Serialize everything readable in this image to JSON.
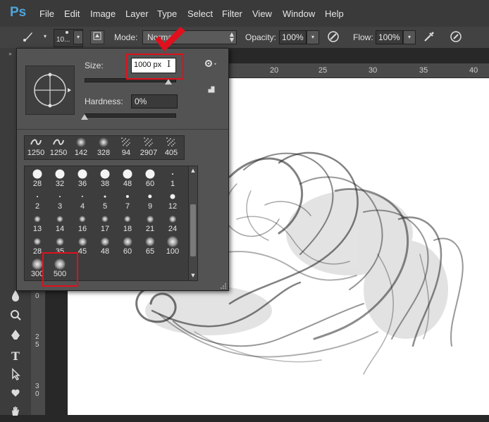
{
  "app": {
    "logo": "Ps"
  },
  "menu": [
    "File",
    "Edit",
    "Image",
    "Layer",
    "Type",
    "Select",
    "Filter",
    "View",
    "Window",
    "Help"
  ],
  "options": {
    "brush_size_readout": "10...",
    "mode_label": "Mode:",
    "mode_value": "Normal",
    "opacity_label": "Opacity:",
    "opacity_value": "100%",
    "flow_label": "Flow:",
    "flow_value": "100%"
  },
  "ruler": {
    "top_ticks": [
      "20",
      "25",
      "30",
      "35",
      "40"
    ],
    "left_ticks": [
      {
        "label": [
          "0"
        ]
      },
      {
        "label": [
          "2",
          "5"
        ]
      },
      {
        "label": [
          "3",
          "0"
        ]
      }
    ]
  },
  "brush_panel": {
    "size_label": "Size:",
    "size_value": "1000 px",
    "size_slider": 0.93,
    "hardness_label": "Hardness:",
    "hardness_value": "0%",
    "hardness_slider": 0.0,
    "recent_brushes": [
      "1250",
      "1250",
      "142",
      "328",
      "94",
      "2907",
      "405"
    ],
    "presets": [
      [
        "28",
        "32",
        "36",
        "38",
        "48",
        "60",
        "1"
      ],
      [
        "2",
        "3",
        "4",
        "5",
        "7",
        "9",
        "12"
      ],
      [
        "13",
        "14",
        "16",
        "17",
        "18",
        "21",
        "24"
      ],
      [
        "28",
        "35",
        "45",
        "48",
        "60",
        "65",
        "100"
      ],
      [
        "300",
        "500"
      ]
    ]
  },
  "colors": {
    "annotation": "#e0101c",
    "logo": "#4fa4dc"
  }
}
